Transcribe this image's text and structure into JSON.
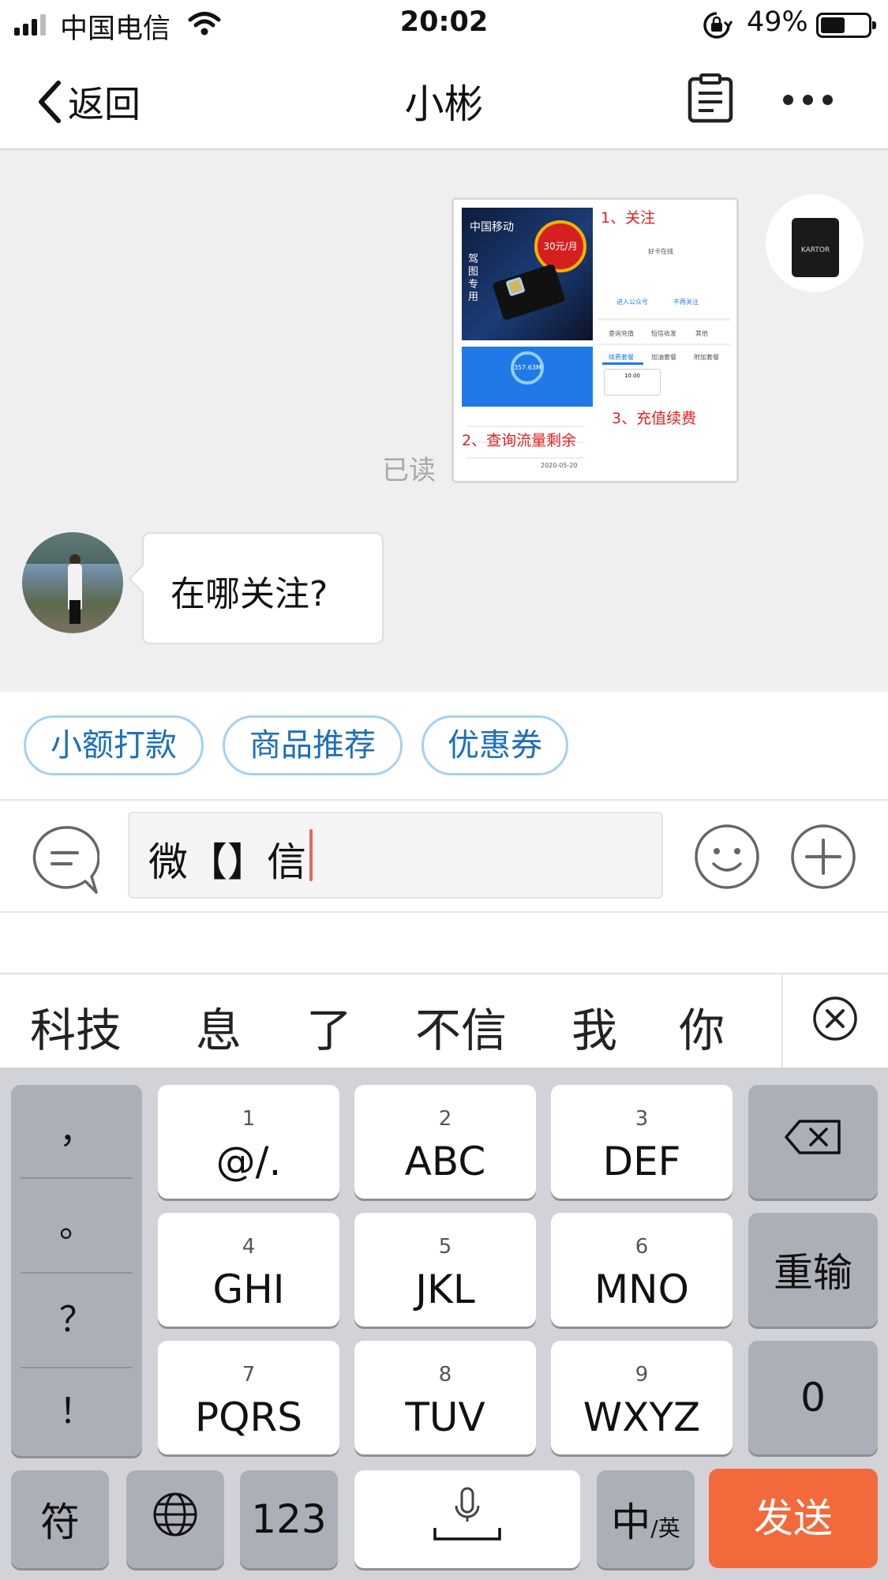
{
  "status_bar": {
    "carrier": "中国电信",
    "time": "20:02",
    "battery_percent": "49%",
    "battery_level": 0.49
  },
  "nav": {
    "back_label": "返回",
    "title": "小彬",
    "icons": [
      "chevron-left-icon",
      "clipboard-icon",
      "more-icon"
    ]
  },
  "chat": {
    "read_status": "已读",
    "image_message": {
      "brand_text": "中国移动",
      "badge_text": "30元/月",
      "vertical_text": "驾图专用",
      "step_1": "1、关注",
      "step_2": "2、查询流量剩余",
      "step_3": "3、充值续费",
      "account_name": "好卡在线",
      "data_remaining": "357.63M",
      "follow_button": "进入公众号",
      "unfollow_button": "不再关注",
      "tabs": [
        "查询充值",
        "短信收发",
        "其他"
      ],
      "subtabs": [
        "续费套餐",
        "加油套餐",
        "附加套餐"
      ],
      "price_value": "10.00",
      "bottom_date": "2020-05-20"
    },
    "right_avatar_label": "KARTOR",
    "incoming_message": "在哪关注?"
  },
  "quick_replies": [
    "小额打款",
    "商品推荐",
    "优惠券"
  ],
  "input": {
    "value": "微【】信"
  },
  "candidates": [
    "科技",
    "息",
    "了",
    "不信",
    "我",
    "你"
  ],
  "keyboard": {
    "punctuation": [
      "，",
      "。",
      "？",
      "！"
    ],
    "keys": [
      {
        "num": "1",
        "label": "@/."
      },
      {
        "num": "2",
        "label": "ABC"
      },
      {
        "num": "3",
        "label": "DEF"
      },
      {
        "num": "4",
        "label": "GHI"
      },
      {
        "num": "5",
        "label": "JKL"
      },
      {
        "num": "6",
        "label": "MNO"
      },
      {
        "num": "7",
        "label": "PQRS"
      },
      {
        "num": "8",
        "label": "TUV"
      },
      {
        "num": "9",
        "label": "WXYZ"
      }
    ],
    "reenter": "重输",
    "zero": "0",
    "symbols": "符",
    "numbers": "123",
    "lang_main": "中",
    "lang_sub": "/英",
    "send": "发送"
  },
  "colors": {
    "chip_text": "#1d6fb8",
    "chip_border": "#a8d0ef",
    "send_button": "#f26a3b",
    "chat_bg": "#efeff0",
    "caret": "#e26b58"
  }
}
